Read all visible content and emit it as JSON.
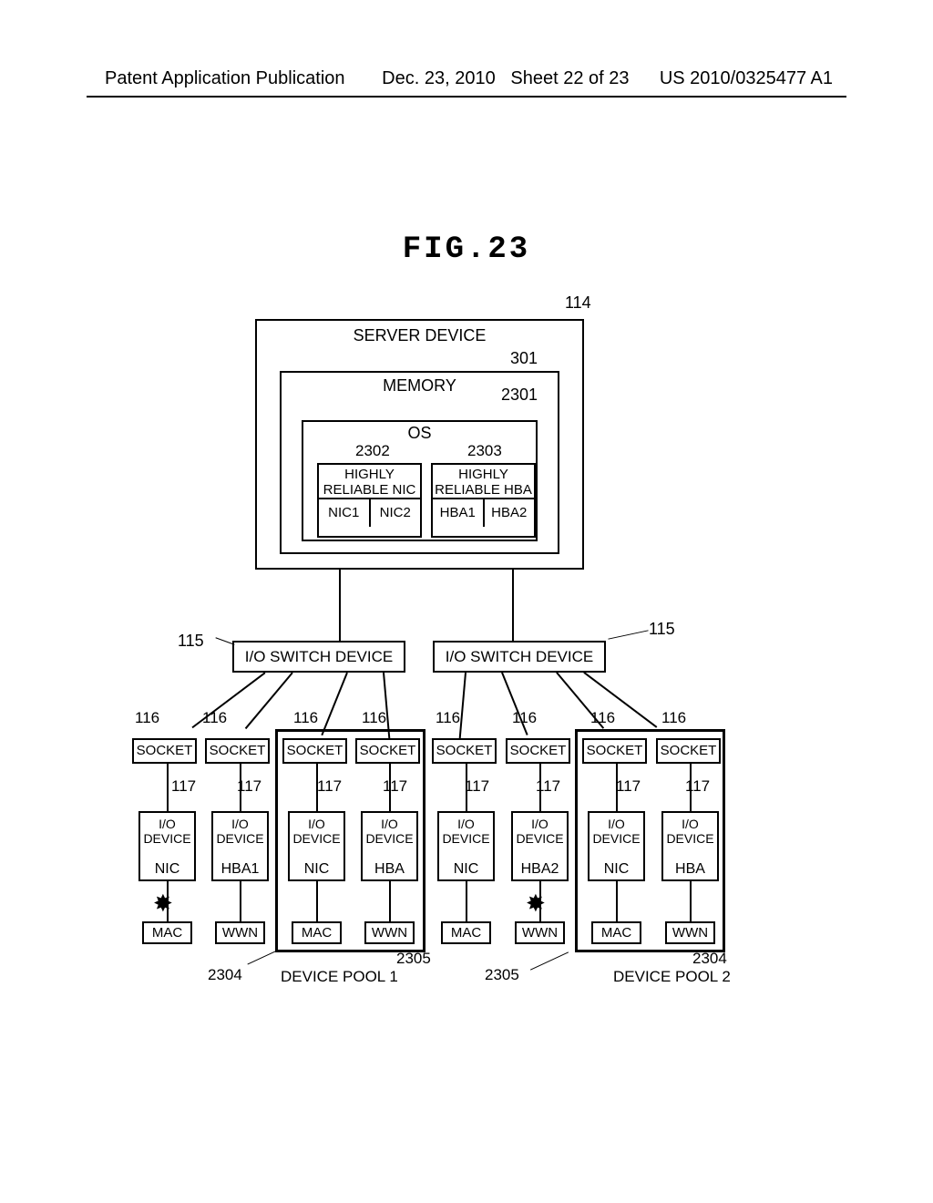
{
  "header": {
    "left": "Patent Application Publication",
    "right_date": "Dec. 23, 2010",
    "right_sheet": "Sheet 22 of 23",
    "right_pub": "US 2010/0325477 A1"
  },
  "figure_title": "FIG.23",
  "refs": {
    "r114": "114",
    "r115": "115",
    "r116": "116",
    "r117": "117",
    "r301": "301",
    "r2301": "2301",
    "r2302": "2302",
    "r2303": "2303",
    "r2304": "2304",
    "r2305": "2305"
  },
  "server": {
    "label": "SERVER DEVICE",
    "memory": "MEMORY",
    "os": "OS",
    "hr_nic_label": "HIGHLY\nRELIABLE NIC",
    "hr_hba_label": "HIGHLY\nRELIABLE HBA",
    "nic1": "NIC1",
    "nic2": "NIC2",
    "hba1": "HBA1",
    "hba2": "HBA2"
  },
  "switch_label": "I/O SWITCH DEVICE",
  "socket_label": "SOCKET",
  "io_device_label": "I/O\nDEVICE",
  "io_types": [
    "NIC",
    "HBA1",
    "NIC",
    "HBA",
    "NIC",
    "HBA2",
    "NIC",
    "HBA"
  ],
  "mw_labels": [
    "MAC",
    "WWN",
    "MAC",
    "WWN",
    "MAC",
    "WWN",
    "MAC",
    "WWN"
  ],
  "pool1_label": "DEVICE POOL 1",
  "pool2_label": "DEVICE POOL 2"
}
